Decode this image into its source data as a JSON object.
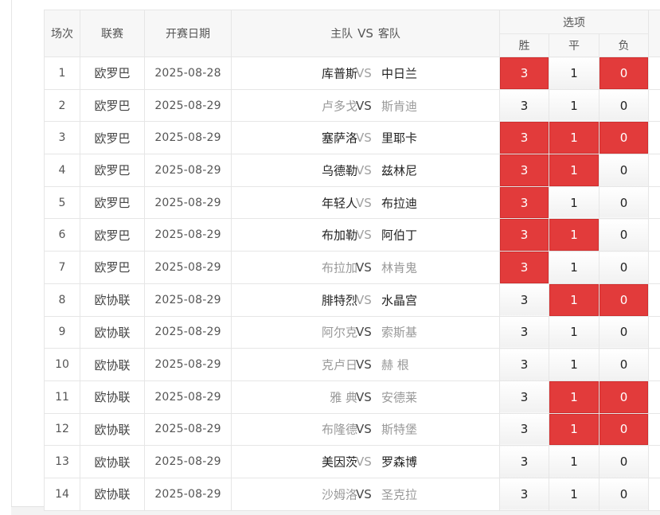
{
  "headers": {
    "index": "场次",
    "league": "联赛",
    "date": "开赛日期",
    "home": "主队",
    "vs": "VS",
    "away": "客队",
    "options": "选项",
    "win": "胜",
    "draw": "平",
    "loss": "负"
  },
  "rows": [
    {
      "idx": "1",
      "league": "欧罗巴",
      "date": "2025-08-28",
      "home": "库普斯",
      "vs": "VS",
      "away": "中日兰",
      "w": "3",
      "d": "1",
      "l": "0",
      "sel": [
        true,
        false,
        true
      ],
      "tone": "dark"
    },
    {
      "idx": "2",
      "league": "欧罗巴",
      "date": "2025-08-29",
      "home": "卢多戈",
      "vs": "VS",
      "away": "斯肯迪",
      "w": "3",
      "d": "1",
      "l": "0",
      "sel": [
        false,
        false,
        false
      ],
      "tone": "light"
    },
    {
      "idx": "3",
      "league": "欧罗巴",
      "date": "2025-08-29",
      "home": "塞萨洛",
      "vs": "VS",
      "away": "里耶卡",
      "w": "3",
      "d": "1",
      "l": "0",
      "sel": [
        true,
        true,
        true
      ],
      "tone": "dark"
    },
    {
      "idx": "4",
      "league": "欧罗巴",
      "date": "2025-08-29",
      "home": "乌德勒",
      "vs": "VS",
      "away": "兹林尼",
      "w": "3",
      "d": "1",
      "l": "0",
      "sel": [
        true,
        true,
        false
      ],
      "tone": "dark"
    },
    {
      "idx": "5",
      "league": "欧罗巴",
      "date": "2025-08-29",
      "home": "年轻人",
      "vs": "VS",
      "away": "布拉迪",
      "w": "3",
      "d": "1",
      "l": "0",
      "sel": [
        true,
        false,
        false
      ],
      "tone": "dark"
    },
    {
      "idx": "6",
      "league": "欧罗巴",
      "date": "2025-08-29",
      "home": "布加勒",
      "vs": "VS",
      "away": "阿伯丁",
      "w": "3",
      "d": "1",
      "l": "0",
      "sel": [
        true,
        true,
        false
      ],
      "tone": "dark"
    },
    {
      "idx": "7",
      "league": "欧罗巴",
      "date": "2025-08-29",
      "home": "布拉加",
      "vs": "VS",
      "away": "林肯鬼",
      "w": "3",
      "d": "1",
      "l": "0",
      "sel": [
        true,
        false,
        false
      ],
      "tone": "light"
    },
    {
      "idx": "8",
      "league": "欧协联",
      "date": "2025-08-29",
      "home": "腓特烈",
      "vs": "VS",
      "away": "水晶宫",
      "w": "3",
      "d": "1",
      "l": "0",
      "sel": [
        false,
        true,
        true
      ],
      "tone": "dark"
    },
    {
      "idx": "9",
      "league": "欧协联",
      "date": "2025-08-29",
      "home": "阿尔克",
      "vs": "VS",
      "away": "索斯基",
      "w": "3",
      "d": "1",
      "l": "0",
      "sel": [
        false,
        false,
        false
      ],
      "tone": "light"
    },
    {
      "idx": "10",
      "league": "欧协联",
      "date": "2025-08-29",
      "home": "克卢日",
      "vs": "VS",
      "away": "赫 根",
      "w": "3",
      "d": "1",
      "l": "0",
      "sel": [
        false,
        false,
        false
      ],
      "tone": "light"
    },
    {
      "idx": "11",
      "league": "欧协联",
      "date": "2025-08-29",
      "home": "雅 典",
      "vs": "VS",
      "away": "安德莱",
      "w": "3",
      "d": "1",
      "l": "0",
      "sel": [
        false,
        true,
        true
      ],
      "tone": "light"
    },
    {
      "idx": "12",
      "league": "欧协联",
      "date": "2025-08-29",
      "home": "布隆德",
      "vs": "VS",
      "away": "斯特堡",
      "w": "3",
      "d": "1",
      "l": "0",
      "sel": [
        false,
        true,
        true
      ],
      "tone": "light"
    },
    {
      "idx": "13",
      "league": "欧协联",
      "date": "2025-08-29",
      "home": "美因茨",
      "vs": "VS",
      "away": "罗森博",
      "w": "3",
      "d": "1",
      "l": "0",
      "sel": [
        false,
        false,
        false
      ],
      "tone": "dark"
    },
    {
      "idx": "14",
      "league": "欧协联",
      "date": "2025-08-29",
      "home": "沙姆洛",
      "vs": "VS",
      "away": "圣克拉",
      "w": "3",
      "d": "1",
      "l": "0",
      "sel": [
        false,
        false,
        false
      ],
      "tone": "light"
    }
  ],
  "colors": {
    "selected": "#e23b3b",
    "header_bg": "#f7f7f7",
    "border": "#e6e6e6"
  }
}
